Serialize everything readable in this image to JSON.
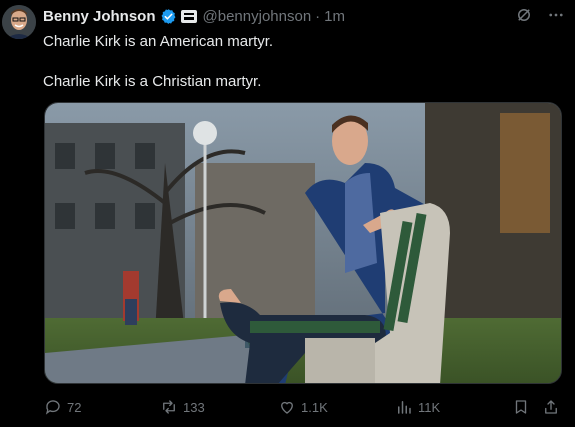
{
  "post": {
    "author_name": "Benny Johnson",
    "handle": "@bennyjohnson",
    "separator": "·",
    "time": "1m",
    "lines": [
      "Charlie Kirk is an American martyr.",
      "Charlie Kirk is a Christian martyr."
    ]
  },
  "actions": {
    "replies": "72",
    "reposts": "133",
    "likes": "1.1K",
    "views": "11K"
  },
  "colors": {
    "background": "#000000",
    "text": "#e7e9ea",
    "muted": "#71767b",
    "verified": "#1d9bf0"
  },
  "icons": [
    "grok-icon",
    "more-icon",
    "verified-badge-icon",
    "affiliate-badge-icon",
    "reply-icon",
    "repost-icon",
    "like-icon",
    "views-icon",
    "bookmark-icon",
    "share-icon"
  ]
}
